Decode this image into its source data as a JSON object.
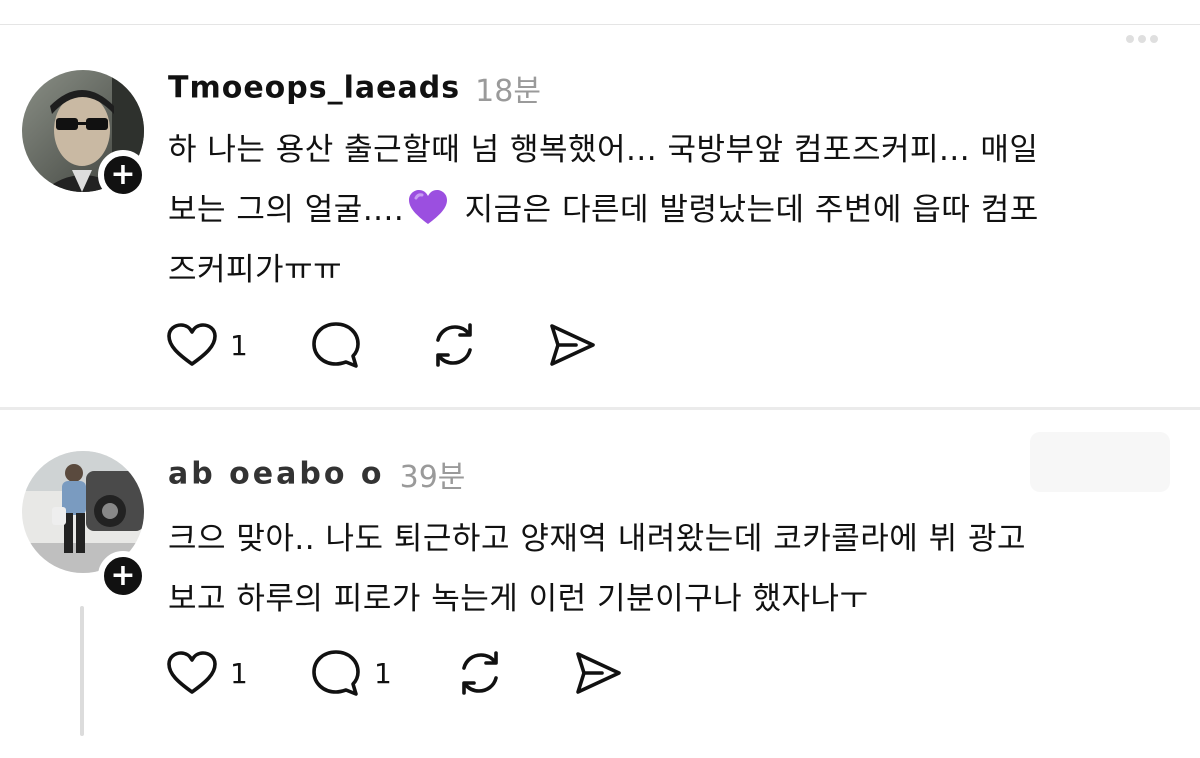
{
  "posts": [
    {
      "username": "Tmoeops_laeads",
      "time": "18분",
      "body_lines": [
        {
          "text": "하 나는 용산 출근할때 넘 행복했어... 국방부앞 컴포즈커피... 매일"
        },
        {
          "before": "보는 그의 얼굴....",
          "emoji": "purple-heart",
          "after": " 지금은 다른데 발령났는데 주변에 읍따 컴포"
        },
        {
          "text": "즈커피가ㅠㅠ"
        }
      ],
      "like_count": "1",
      "reply_count": ""
    },
    {
      "username": "ab oeabo o",
      "time": "39분",
      "body_lines": [
        {
          "text": "크으 맞아.. 나도 퇴근하고 양재역 내려왔는데 코카콜라에 뷔 광고"
        },
        {
          "text": "보고 하루의 피로가 녹는게 이런 기분이구나 했자나ㅜ"
        }
      ],
      "like_count": "1",
      "reply_count": "1"
    }
  ],
  "icons": {
    "follow": "plus-icon",
    "like": "heart-icon",
    "reply": "comment-icon",
    "repost": "repost-icon",
    "share": "send-icon"
  },
  "colors": {
    "text": "#111111",
    "timestamp": "#9a9a9a",
    "emoji_heart": "#9b4fe0",
    "divider": "#e5e5e5"
  },
  "follow_glyph": "+"
}
